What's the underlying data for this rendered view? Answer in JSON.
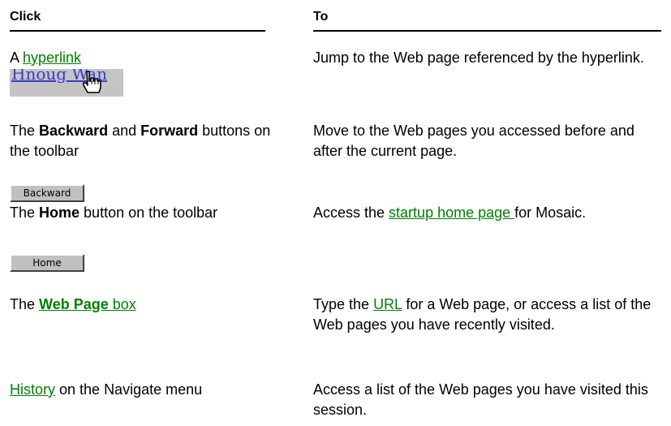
{
  "headers": {
    "click": "Click",
    "to": "To"
  },
  "rows": [
    {
      "click_pre": "A ",
      "click_link": "hyperlink",
      "to": "Jump to the Web page referenced by the hyperlink."
    },
    {
      "click_a": "The ",
      "click_b1": "Backward",
      "click_c": " and ",
      "click_b2": "Forward",
      "click_d": " buttons on the toolbar",
      "button": "Backward",
      "to": "Move to the Web pages you accessed before and after the current page."
    },
    {
      "click_a": "The ",
      "click_b": "Home",
      "click_c": " button on the toolbar",
      "button": "Home",
      "to_pre": "Access the ",
      "to_link": "startup home page ",
      "to_post": " for Mosaic."
    },
    {
      "click_a": "The ",
      "click_link_bold": "Web Page",
      "click_link_rest": " box",
      "to_pre": "Type the ",
      "to_link": "URL",
      "to_post": " for a Web page, or access a list of the Web pages you have recently visited."
    },
    {
      "click_link": "History",
      "click_rest": " on the Navigate menu",
      "to": "Access a list of the Web pages you have visited this session."
    }
  ],
  "colors": {
    "link": "#008000",
    "button_face": "#c0c0c0",
    "image_bg": "#c4c4c4"
  },
  "icons": {
    "hand": "pointing-hand-icon"
  }
}
